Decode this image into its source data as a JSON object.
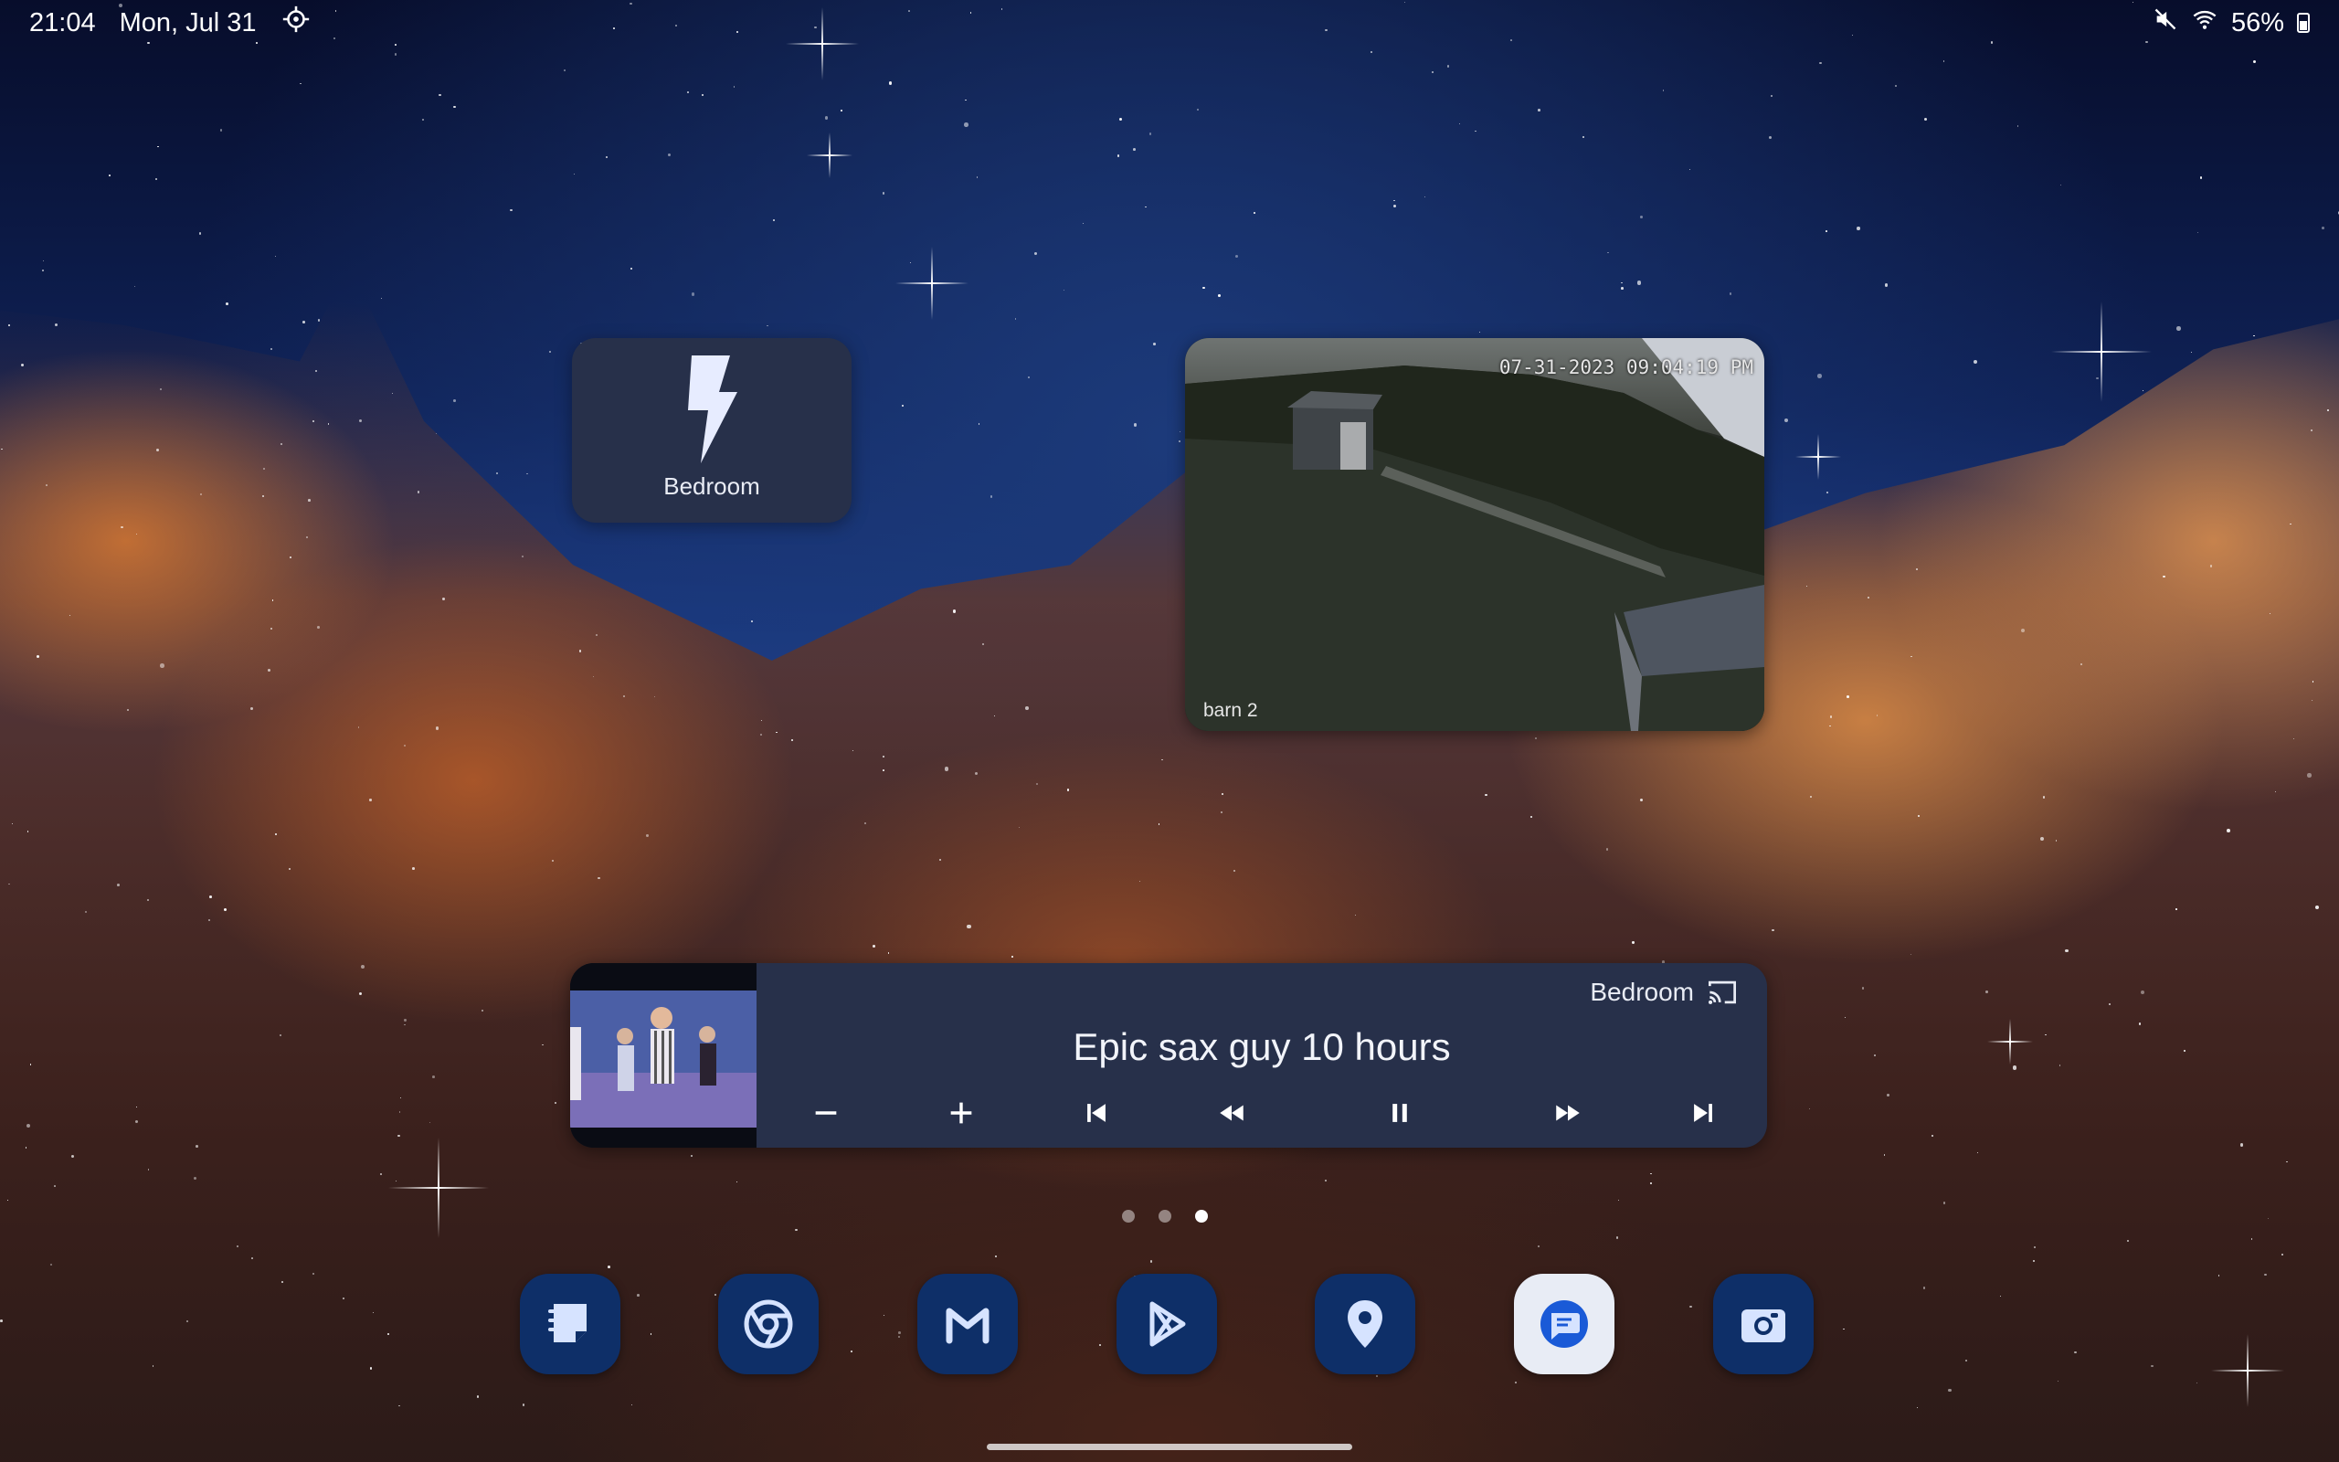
{
  "status_bar": {
    "time": "21:04",
    "date": "Mon, Jul 31",
    "battery": "56%"
  },
  "widgets": {
    "bedroom_tile": {
      "label": "Bedroom",
      "icon": "lightning-bolt-icon"
    },
    "camera": {
      "timestamp": "07-31-2023 09:04:19 PM",
      "name": "barn 2"
    },
    "media": {
      "cast_target": "Bedroom",
      "title": "Epic sax guy 10 hours",
      "controls": [
        "volume-down-icon",
        "volume-up-icon",
        "skip-previous-icon",
        "rewind-icon",
        "pause-icon",
        "fast-forward-icon",
        "skip-next-icon"
      ]
    }
  },
  "page_indicator": {
    "count": 3,
    "active": 3
  },
  "dock": {
    "apps": [
      "notes",
      "chrome",
      "gmail",
      "play-store",
      "maps",
      "messages",
      "camera"
    ]
  },
  "colors": {
    "widget_bg": "#27304a",
    "dock_icon_bg": "#0e2f68",
    "dock_icon_fg": "#d6e3ff"
  }
}
